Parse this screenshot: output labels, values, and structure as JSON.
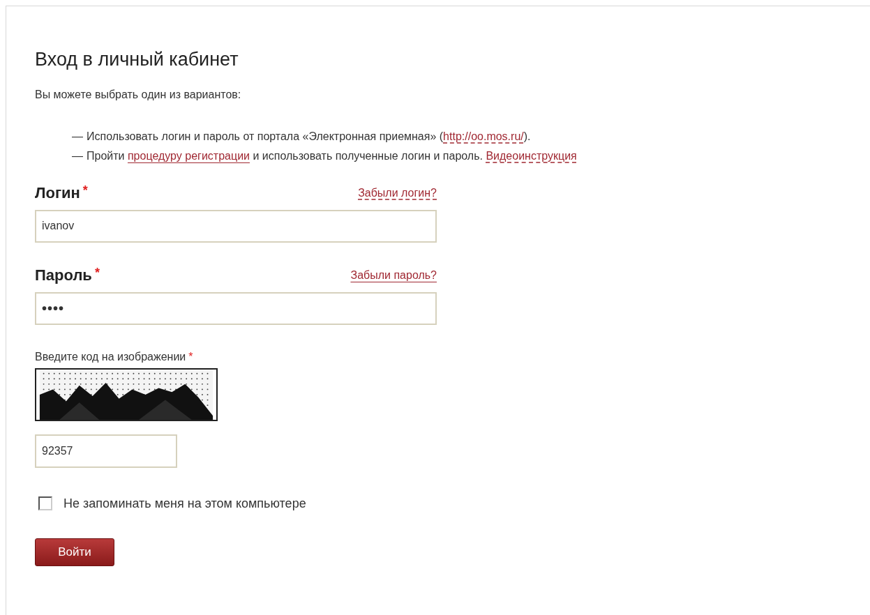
{
  "title": "Вход в личный кабинет",
  "intro": "Вы можете выбрать один из вариантов:",
  "options": [
    {
      "marker": "—",
      "parts": [
        {
          "kind": "text",
          "text": "Использовать логин и пароль от портала «Электронная приемная» ("
        },
        {
          "kind": "dashed-link",
          "text": "http://oo.mos.ru/"
        },
        {
          "kind": "text",
          "text": ")."
        }
      ]
    },
    {
      "marker": "—",
      "parts": [
        {
          "kind": "text",
          "text": "Пройти "
        },
        {
          "kind": "link",
          "text": "процедуру регистрации"
        },
        {
          "kind": "text",
          "text": " и использовать полученные логин и пароль. "
        },
        {
          "kind": "dashed-link",
          "text": "Видеоинструкция"
        }
      ]
    }
  ],
  "login": {
    "label": "Логин",
    "required": "*",
    "link": {
      "kind": "dashed-link",
      "text": "Забыли логин?"
    },
    "value": "ivanov"
  },
  "password": {
    "label": "Пароль",
    "required": "*",
    "link": {
      "kind": "link",
      "text": "Забыли пароль?"
    },
    "value": "••••"
  },
  "captcha": {
    "label": "Введите код на изображении",
    "required": "*",
    "value": "92357"
  },
  "remember": {
    "label": "Не запоминать меня на этом компьютере",
    "checked": false
  },
  "submit": "Войти"
}
